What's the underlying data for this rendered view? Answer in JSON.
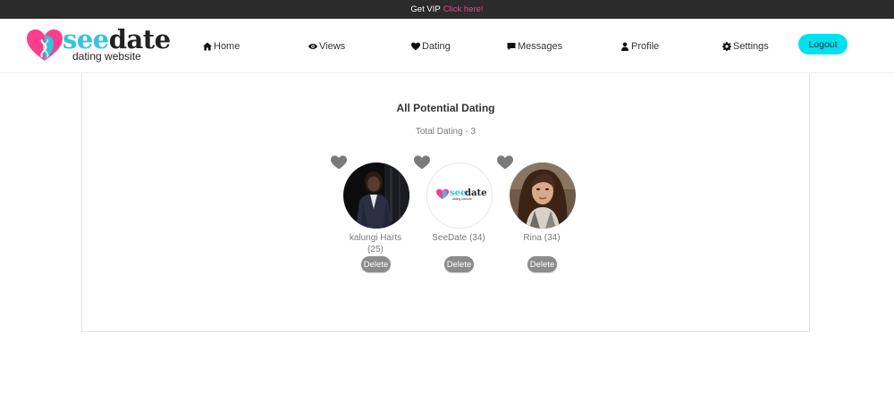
{
  "topbar": {
    "text": "Get VIP",
    "link": "Click here!"
  },
  "brand": {
    "word_a": "see",
    "word_b": "date",
    "tagline": "dating website",
    "color_primary": "#2ec6e0",
    "color_secondary": "#ff3d8b"
  },
  "nav": [
    {
      "label": "Home",
      "icon": "home-icon"
    },
    {
      "label": "Views",
      "icon": "eye-icon"
    },
    {
      "label": "Dating",
      "icon": "heart-icon"
    },
    {
      "label": "Messages",
      "icon": "chat-icon"
    },
    {
      "label": "Profile",
      "icon": "user-icon"
    },
    {
      "label": "Settings",
      "icon": "gear-icon"
    }
  ],
  "logout_label": "Logout",
  "page": {
    "title": "All Potential Dating",
    "subtitle": "Total Dating - 3"
  },
  "matches": [
    {
      "name_line1": "kalungi Harts",
      "name_line2": "(25)",
      "delete_label": "Delete"
    },
    {
      "name_line1": "SeeDate (34)",
      "name_line2": "",
      "delete_label": "Delete",
      "avatar_logo_a": "see",
      "avatar_logo_b": "date",
      "avatar_tag": "dating website"
    },
    {
      "name_line1": "Rina (34)",
      "name_line2": "",
      "delete_label": "Delete"
    }
  ]
}
